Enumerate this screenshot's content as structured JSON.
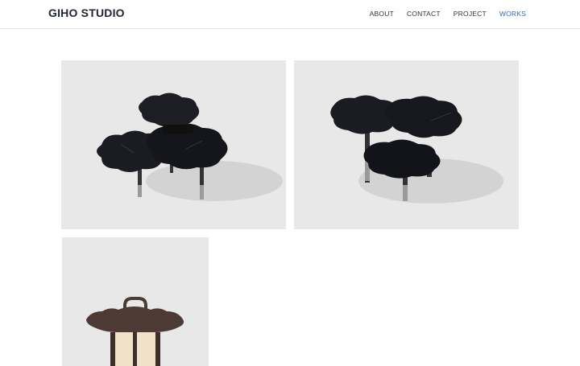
{
  "header": {
    "logo": "GIHO STUDIO",
    "nav": [
      {
        "label": "ABOUT",
        "active": false
      },
      {
        "label": "CONTACT",
        "active": false
      },
      {
        "label": "PROJECT",
        "active": false
      },
      {
        "label": "WORKS",
        "active": true
      }
    ]
  },
  "gallery": {
    "items": [
      {
        "subject": "black flower-shaped tiered side table"
      },
      {
        "subject": "black flower-shaped tiered side table, alternate view"
      },
      {
        "subject": "wooden lantern with scalloped top and handle"
      }
    ]
  },
  "colors": {
    "brand_text": "#1e2633",
    "nav_text": "#333333",
    "nav_active": "#2a6fb0",
    "tile_bg": "#e8e8e8"
  }
}
